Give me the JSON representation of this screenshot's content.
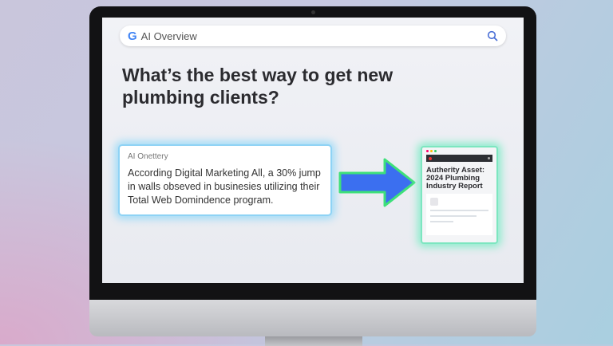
{
  "search": {
    "logo": "G",
    "placeholder": "AI Overview",
    "icon": "search-icon"
  },
  "heading": "What’s the best way to get new plumbing clients?",
  "ai_box": {
    "label": "AI Onettery",
    "text": "According Digital Marketing All, a 30% jump in walls obseved in businesies utilizing their Total Web Domindence program."
  },
  "card": {
    "title": "Autherity Asset: 2024 Plumbing Industry Report"
  },
  "colors": {
    "accent_blue": "#3b6ff0",
    "glow_blue": "#8fd3f5",
    "glow_green": "#7de6c0"
  }
}
